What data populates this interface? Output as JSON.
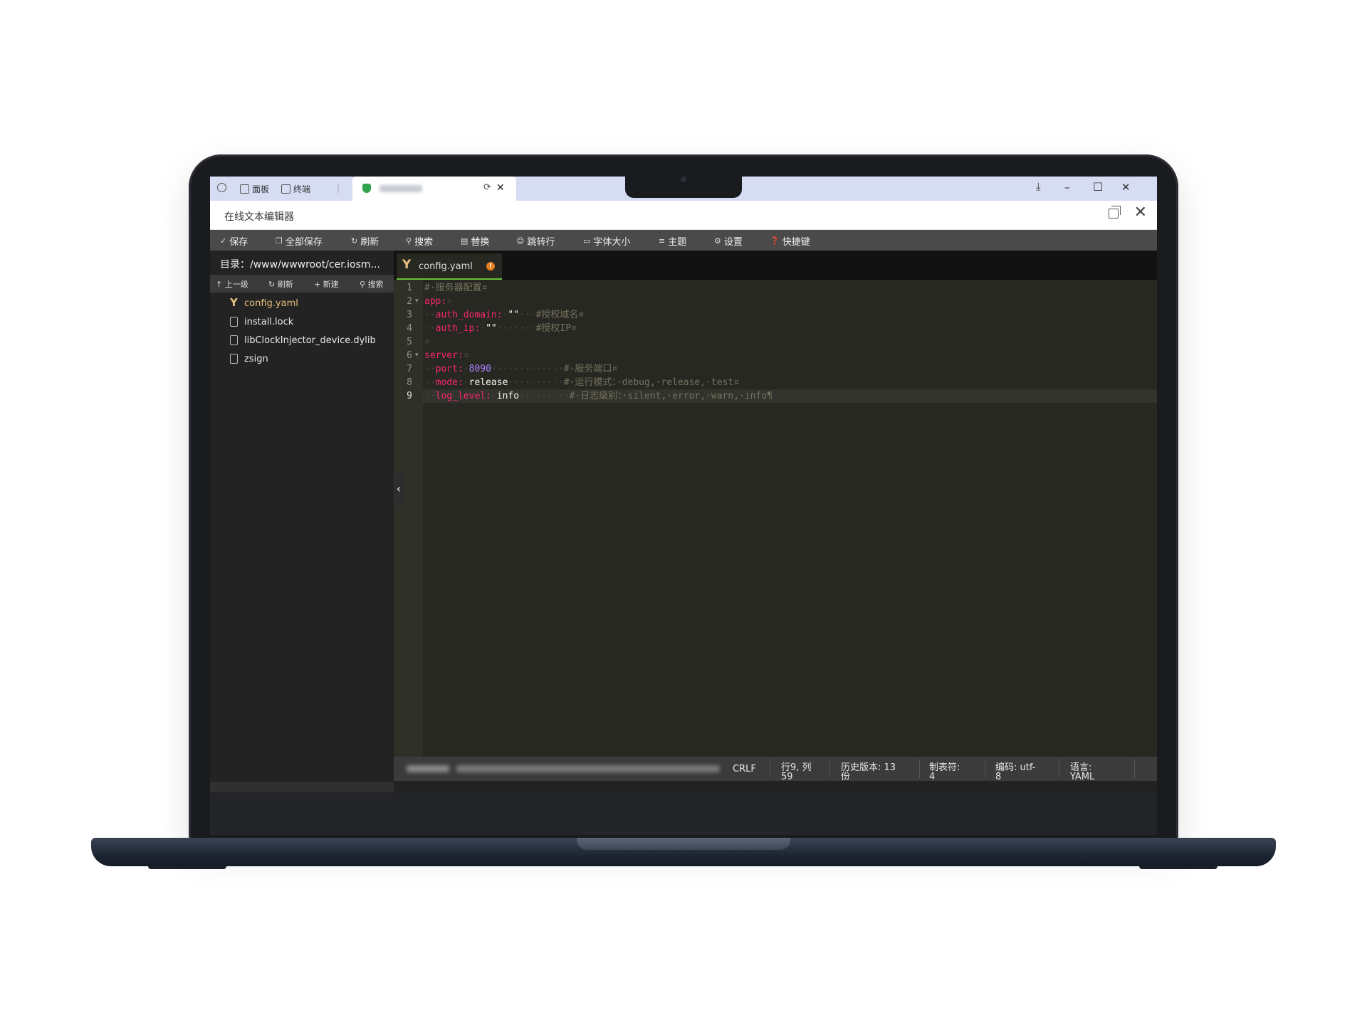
{
  "browser": {
    "tab_panel": "面板",
    "tab_terminal": "终端",
    "refresh_glyph": "⟳",
    "close_glyph": "✕"
  },
  "app": {
    "title": "在线文本编辑器"
  },
  "toolbar": {
    "save": "保存",
    "save_all": "全部保存",
    "refresh": "刷新",
    "search": "搜索",
    "replace": "替换",
    "goto_line": "跳转行",
    "font_size": "字体大小",
    "theme": "主题",
    "settings": "设置",
    "shortcuts": "快捷键"
  },
  "sidebar": {
    "dir_path": "目录：/www/wwwroot/cer.iosm...",
    "actions": {
      "up": "上一级",
      "refresh": "刷新",
      "new": "新建",
      "search": "搜索"
    },
    "files": [
      {
        "name": "config.yaml",
        "type": "yaml",
        "active": true
      },
      {
        "name": "install.lock",
        "type": "file"
      },
      {
        "name": "libClockInjector_device.dylib",
        "type": "file"
      },
      {
        "name": "zsign",
        "type": "file"
      }
    ]
  },
  "editor": {
    "tab_name": "config.yaml",
    "tab_modified_glyph": "!",
    "line_numbers": [
      "1",
      "2",
      "3",
      "4",
      "5",
      "6",
      "7",
      "8",
      "9"
    ],
    "lines": {
      "l1_comment": "#·服务器配置¤",
      "l2_key": "app:",
      "l2_ws": "¤",
      "l3_ws1": "··",
      "l3_key": "auth_domain:",
      "l3_ws2": "·",
      "l3_str": "\"\"",
      "l3_ws3": "···",
      "l3_comment": "#授权域名¤",
      "l4_ws1": "··",
      "l4_key": "auth_ip:",
      "l4_ws2": "·",
      "l4_str": "\"\"",
      "l4_ws3": "·······",
      "l4_comment": "#授权IP¤",
      "l5_ws": "¤",
      "l6_key": "server:",
      "l6_ws": "¤",
      "l7_ws1": "··",
      "l7_key": "port:",
      "l7_ws2": "·",
      "l7_num": "8090",
      "l7_ws3": "·············",
      "l7_comment": "#·服务端口¤",
      "l8_ws1": "··",
      "l8_key": "mode:",
      "l8_ws2": "·",
      "l8_val": "release",
      "l8_ws3": "··········",
      "l8_comment": "#·运行模式：·debug,·release,·test¤",
      "l9_ws1": "··",
      "l9_key": "log_level:",
      "l9_ws2": "·",
      "l9_val": "info",
      "l9_ws3": "·········",
      "l9_comment": "#·日志级别：·silent,·error,·warn,·info¶"
    }
  },
  "status": {
    "line_ending": "CRLF",
    "cursor_a": "行9, 列",
    "cursor_b": "59",
    "history_a": "历史版本: 13",
    "history_b": "份",
    "tab_a": "制表符:",
    "tab_b": "4",
    "encoding_a": "编码: utf-",
    "encoding_b": "8",
    "lang_a": "语言:",
    "lang_b": "YAML"
  },
  "colors": {
    "toolbar_bg": "#4a4a4a",
    "editor_bg": "#272822",
    "yaml_key": "#f92672",
    "yaml_comment": "#75715e",
    "yaml_number": "#ae81ff",
    "active_file": "#e5c07b",
    "tab_accent": "#67c23a",
    "modified_dot": "#e67e22"
  }
}
